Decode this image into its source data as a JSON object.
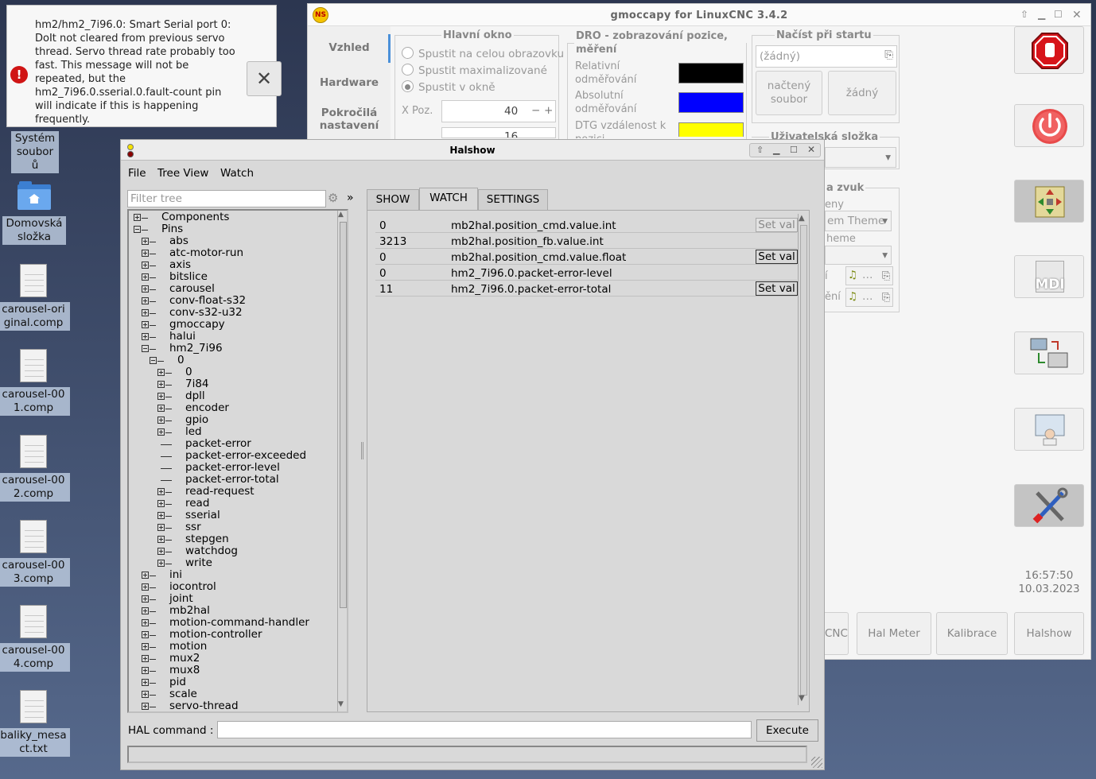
{
  "notification": {
    "message": "hm2/hm2_7i96.0: Smart Serial port 0: DoIt not cleared from previous servo thread. Servo thread rate probably too fast. This message will not be repeated, but the hm2_7i96.0.sserial.0.fault-count pin will indicate if this is happening frequently.",
    "error_glyph": "!",
    "close_glyph": "✕"
  },
  "desktop": {
    "icons": [
      {
        "label": "Systém souborů"
      },
      {
        "label": "Domovská složka"
      },
      {
        "label": "carousel-original.comp"
      },
      {
        "label": "carousel-001.comp"
      },
      {
        "label": "carousel-002.comp"
      },
      {
        "label": "carousel-003.comp"
      },
      {
        "label": "carousel-004.comp"
      },
      {
        "label": "baliky_mesact.txt"
      }
    ]
  },
  "gmoccapy": {
    "title": "gmoccapy for LinuxCNC  3.4.2",
    "logo_text": "NS",
    "sidebar": [
      "Vzhled",
      "Hardware",
      "Pokročilá nastavení"
    ],
    "main_window": {
      "legend": "Hlavní okno",
      "options": [
        "Spustit na celou obrazovku",
        "Spustit maximalizované",
        "Spustit v okně"
      ],
      "x_label": "X Poz.",
      "x_value": "40",
      "y_value": "16",
      "minus": "−",
      "plus": "+"
    },
    "dro": {
      "legend": "DRO - zobrazování pozice, měření",
      "rel_label": "Relativní odměřování",
      "abs_label": "Absolutní odměřování",
      "dtg_label": "DTG vzdálenost k pozici",
      "rel_color": "#000000",
      "abs_color": "#0000ff",
      "dtg_color": "#ffff00"
    },
    "startup": {
      "legend": "Načíst při startu",
      "file_value": "(žádný)",
      "loaded_btn": "načtený soubor",
      "none_btn": "žádný"
    },
    "user_folder_legend": "Uživatelská složka",
    "sound_legend": "a zvuk",
    "partial_texts": [
      "eny",
      "em Theme",
      "heme",
      "í",
      "ění"
    ],
    "file_icon": "…",
    "clock_time": "16:57:50",
    "clock_date": "10.03.2023",
    "bottom_buttons": [
      "CNC",
      "Hal Meter",
      "Kalibrace",
      "Halshow"
    ],
    "right_buttons": [
      "estop-icon",
      "power-icon",
      "jog-icon",
      "MDI",
      "auto-icon",
      "user-tabs-icon",
      "settings-icon"
    ]
  },
  "halshow": {
    "title": "Halshow",
    "menu": [
      "File",
      "Tree View",
      "Watch"
    ],
    "filter_placeholder": "Filter tree",
    "more": "»",
    "tabs": [
      "SHOW",
      "WATCH",
      "SETTINGS"
    ],
    "tree": [
      {
        "label": "Components",
        "level": 0,
        "box": "plus"
      },
      {
        "label": "Pins",
        "level": 0,
        "box": "minus"
      },
      {
        "label": "abs",
        "level": 1,
        "box": "plus"
      },
      {
        "label": "atc-motor-run",
        "level": 1,
        "box": "plus"
      },
      {
        "label": "axis",
        "level": 1,
        "box": "plus"
      },
      {
        "label": "bitslice",
        "level": 1,
        "box": "plus"
      },
      {
        "label": "carousel",
        "level": 1,
        "box": "plus"
      },
      {
        "label": "conv-float-s32",
        "level": 1,
        "box": "plus"
      },
      {
        "label": "conv-s32-u32",
        "level": 1,
        "box": "plus"
      },
      {
        "label": "gmoccapy",
        "level": 1,
        "box": "plus"
      },
      {
        "label": "halui",
        "level": 1,
        "box": "plus"
      },
      {
        "label": "hm2_7i96",
        "level": 1,
        "box": "minus"
      },
      {
        "label": "0",
        "level": 2,
        "box": "minus"
      },
      {
        "label": "0",
        "level": 3,
        "box": "plus"
      },
      {
        "label": "7i84",
        "level": 3,
        "box": "plus"
      },
      {
        "label": "dpll",
        "level": 3,
        "box": "plus"
      },
      {
        "label": "encoder",
        "level": 3,
        "box": "plus"
      },
      {
        "label": "gpio",
        "level": 3,
        "box": "plus"
      },
      {
        "label": "led",
        "level": 3,
        "box": "plus"
      },
      {
        "label": "packet-error",
        "level": 3,
        "box": "none"
      },
      {
        "label": "packet-error-exceeded",
        "level": 3,
        "box": "none"
      },
      {
        "label": "packet-error-level",
        "level": 3,
        "box": "none"
      },
      {
        "label": "packet-error-total",
        "level": 3,
        "box": "none"
      },
      {
        "label": "read-request",
        "level": 3,
        "box": "plus"
      },
      {
        "label": "read",
        "level": 3,
        "box": "plus"
      },
      {
        "label": "sserial",
        "level": 3,
        "box": "plus"
      },
      {
        "label": "ssr",
        "level": 3,
        "box": "plus"
      },
      {
        "label": "stepgen",
        "level": 3,
        "box": "plus"
      },
      {
        "label": "watchdog",
        "level": 3,
        "box": "plus"
      },
      {
        "label": "write",
        "level": 3,
        "box": "plus"
      },
      {
        "label": "ini",
        "level": 1,
        "box": "plus"
      },
      {
        "label": "iocontrol",
        "level": 1,
        "box": "plus"
      },
      {
        "label": "joint",
        "level": 1,
        "box": "plus"
      },
      {
        "label": "mb2hal",
        "level": 1,
        "box": "plus"
      },
      {
        "label": "motion-command-handler",
        "level": 1,
        "box": "plus"
      },
      {
        "label": "motion-controller",
        "level": 1,
        "box": "plus"
      },
      {
        "label": "motion",
        "level": 1,
        "box": "plus"
      },
      {
        "label": "mux2",
        "level": 1,
        "box": "plus"
      },
      {
        "label": "mux8",
        "level": 1,
        "box": "plus"
      },
      {
        "label": "pid",
        "level": 1,
        "box": "plus"
      },
      {
        "label": "scale",
        "level": 1,
        "box": "plus"
      },
      {
        "label": "servo-thread",
        "level": 1,
        "box": "plus"
      }
    ],
    "watch": [
      {
        "value": "0",
        "name": "mb2hal.position_cmd.value.int",
        "setval": "Set val",
        "dim": true
      },
      {
        "value": "3213",
        "name": "mb2hal.position_fb.value.int",
        "setval": "",
        "dim": false
      },
      {
        "value": "0",
        "name": "mb2hal.position_cmd.value.float",
        "setval": "Set val",
        "dim": false
      },
      {
        "value": "0",
        "name": "hm2_7i96.0.packet-error-level",
        "setval": "",
        "dim": false
      },
      {
        "value": "11",
        "name": "hm2_7i96.0.packet-error-total",
        "setval": "Set val",
        "dim": false
      }
    ],
    "hal_command_label": "HAL command :",
    "execute_label": "Execute"
  }
}
